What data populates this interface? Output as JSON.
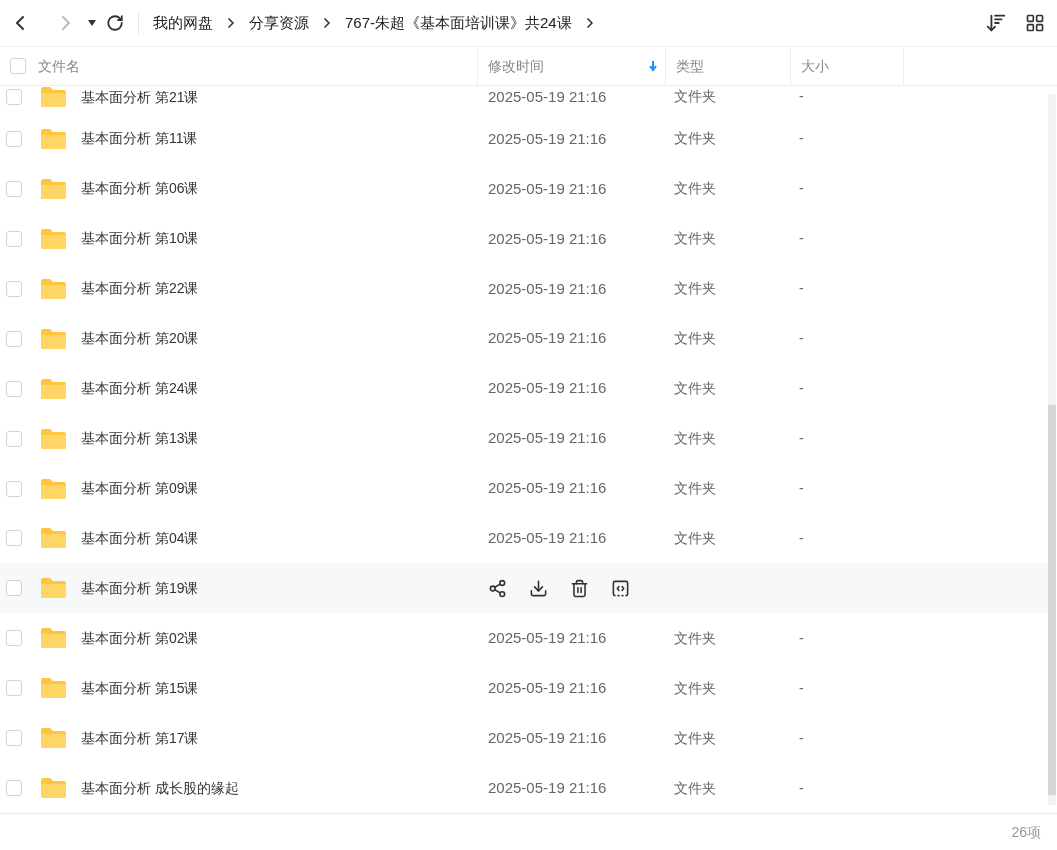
{
  "breadcrumb": [
    "我的网盘",
    "分享资源",
    "767-朱超《基本面培训课》共24课"
  ],
  "select_all": {
    "checked": false
  },
  "columns": [
    {
      "label": "文件名",
      "sorted": false
    },
    {
      "label": "修改时间",
      "sorted": true
    },
    {
      "label": "类型",
      "sorted": false
    },
    {
      "label": "大小",
      "sorted": false
    }
  ],
  "rows": [
    {
      "name": "基本面分析 第21课",
      "modified": "2025-05-19 21:16",
      "type": "文件夹",
      "size": "-",
      "checked": false,
      "hovered": false,
      "cut": true
    },
    {
      "name": "基本面分析 第11课",
      "modified": "2025-05-19 21:16",
      "type": "文件夹",
      "size": "-",
      "checked": false,
      "hovered": false
    },
    {
      "name": "基本面分析 第06课",
      "modified": "2025-05-19 21:16",
      "type": "文件夹",
      "size": "-",
      "checked": false,
      "hovered": false
    },
    {
      "name": "基本面分析 第10课",
      "modified": "2025-05-19 21:16",
      "type": "文件夹",
      "size": "-",
      "checked": false,
      "hovered": false
    },
    {
      "name": "基本面分析 第22课",
      "modified": "2025-05-19 21:16",
      "type": "文件夹",
      "size": "-",
      "checked": false,
      "hovered": false
    },
    {
      "name": "基本面分析 第20课",
      "modified": "2025-05-19 21:16",
      "type": "文件夹",
      "size": "-",
      "checked": false,
      "hovered": false
    },
    {
      "name": "基本面分析 第24课",
      "modified": "2025-05-19 21:16",
      "type": "文件夹",
      "size": "-",
      "checked": false,
      "hovered": false
    },
    {
      "name": "基本面分析 第13课",
      "modified": "2025-05-19 21:16",
      "type": "文件夹",
      "size": "-",
      "checked": false,
      "hovered": false
    },
    {
      "name": "基本面分析 第09课",
      "modified": "2025-05-19 21:16",
      "type": "文件夹",
      "size": "-",
      "checked": false,
      "hovered": false
    },
    {
      "name": "基本面分析 第04课",
      "modified": "2025-05-19 21:16",
      "type": "文件夹",
      "size": "-",
      "checked": false,
      "hovered": false
    },
    {
      "name": "基本面分析 第19课",
      "checked": false,
      "hovered": true
    },
    {
      "name": "基本面分析 第02课",
      "modified": "2025-05-19 21:16",
      "type": "文件夹",
      "size": "-",
      "checked": false,
      "hovered": false
    },
    {
      "name": "基本面分析 第15课",
      "modified": "2025-05-19 21:16",
      "type": "文件夹",
      "size": "-",
      "checked": false,
      "hovered": false
    },
    {
      "name": "基本面分析 第17课",
      "modified": "2025-05-19 21:16",
      "type": "文件夹",
      "size": "-",
      "checked": false,
      "hovered": false
    },
    {
      "name": "基本面分析 成长股的缘起",
      "modified": "2025-05-19 21:16",
      "type": "文件夹",
      "size": "-",
      "checked": false,
      "hovered": false
    }
  ],
  "status": "26项"
}
